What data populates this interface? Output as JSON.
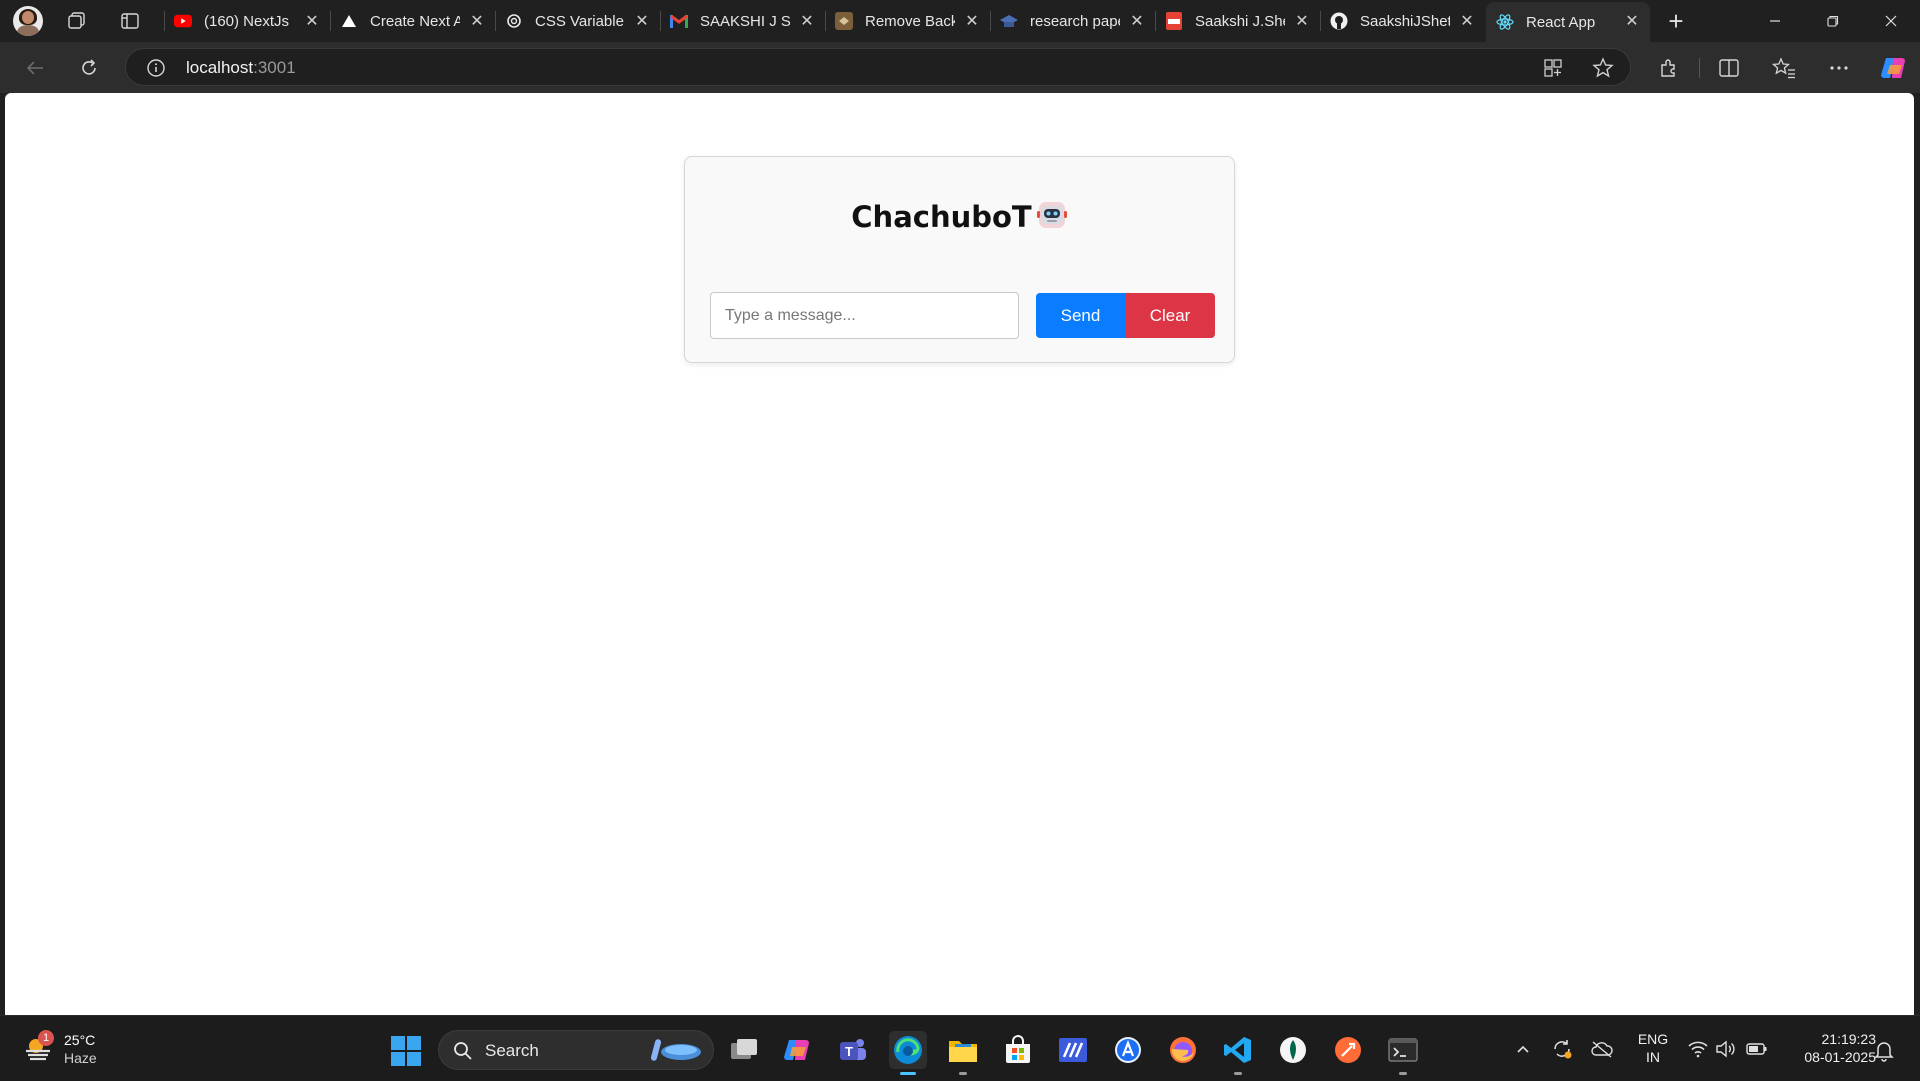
{
  "browser": {
    "tabs": [
      {
        "title": "(160) NextJs |",
        "icon": "youtube-icon",
        "active": false
      },
      {
        "title": "Create Next A",
        "icon": "nextjs-icon",
        "active": false
      },
      {
        "title": "CSS Variable |",
        "icon": "chatgpt-icon",
        "active": false
      },
      {
        "title": "SAAKSHI J SH",
        "icon": "gmail-icon",
        "active": false
      },
      {
        "title": "Remove Back",
        "icon": "removebg-icon",
        "active": false
      },
      {
        "title": "research pape",
        "icon": "graduation-cap-icon",
        "active": false
      },
      {
        "title": "Saakshi J.She",
        "icon": "pdf-icon",
        "active": false
      },
      {
        "title": "SaakshiJShett",
        "icon": "github-icon",
        "active": false
      },
      {
        "title": "React App",
        "icon": "react-icon",
        "active": true
      }
    ],
    "address": {
      "host": "localhost",
      "port": ":3001"
    }
  },
  "app": {
    "title": "ChachuboT",
    "title_emoji_icon": "robot-icon",
    "input_placeholder": "Type a message...",
    "send_label": "Send",
    "clear_label": "Clear",
    "colors": {
      "send": "#0a7cff",
      "clear": "#dc3545"
    }
  },
  "taskbar": {
    "weather": {
      "temp": "25°C",
      "condition": "Haze",
      "badge": "1"
    },
    "search_label": "Search",
    "language": {
      "line1": "ENG",
      "line2": "IN"
    },
    "clock": {
      "time": "21:19:23",
      "date": "08-01-2025"
    }
  }
}
